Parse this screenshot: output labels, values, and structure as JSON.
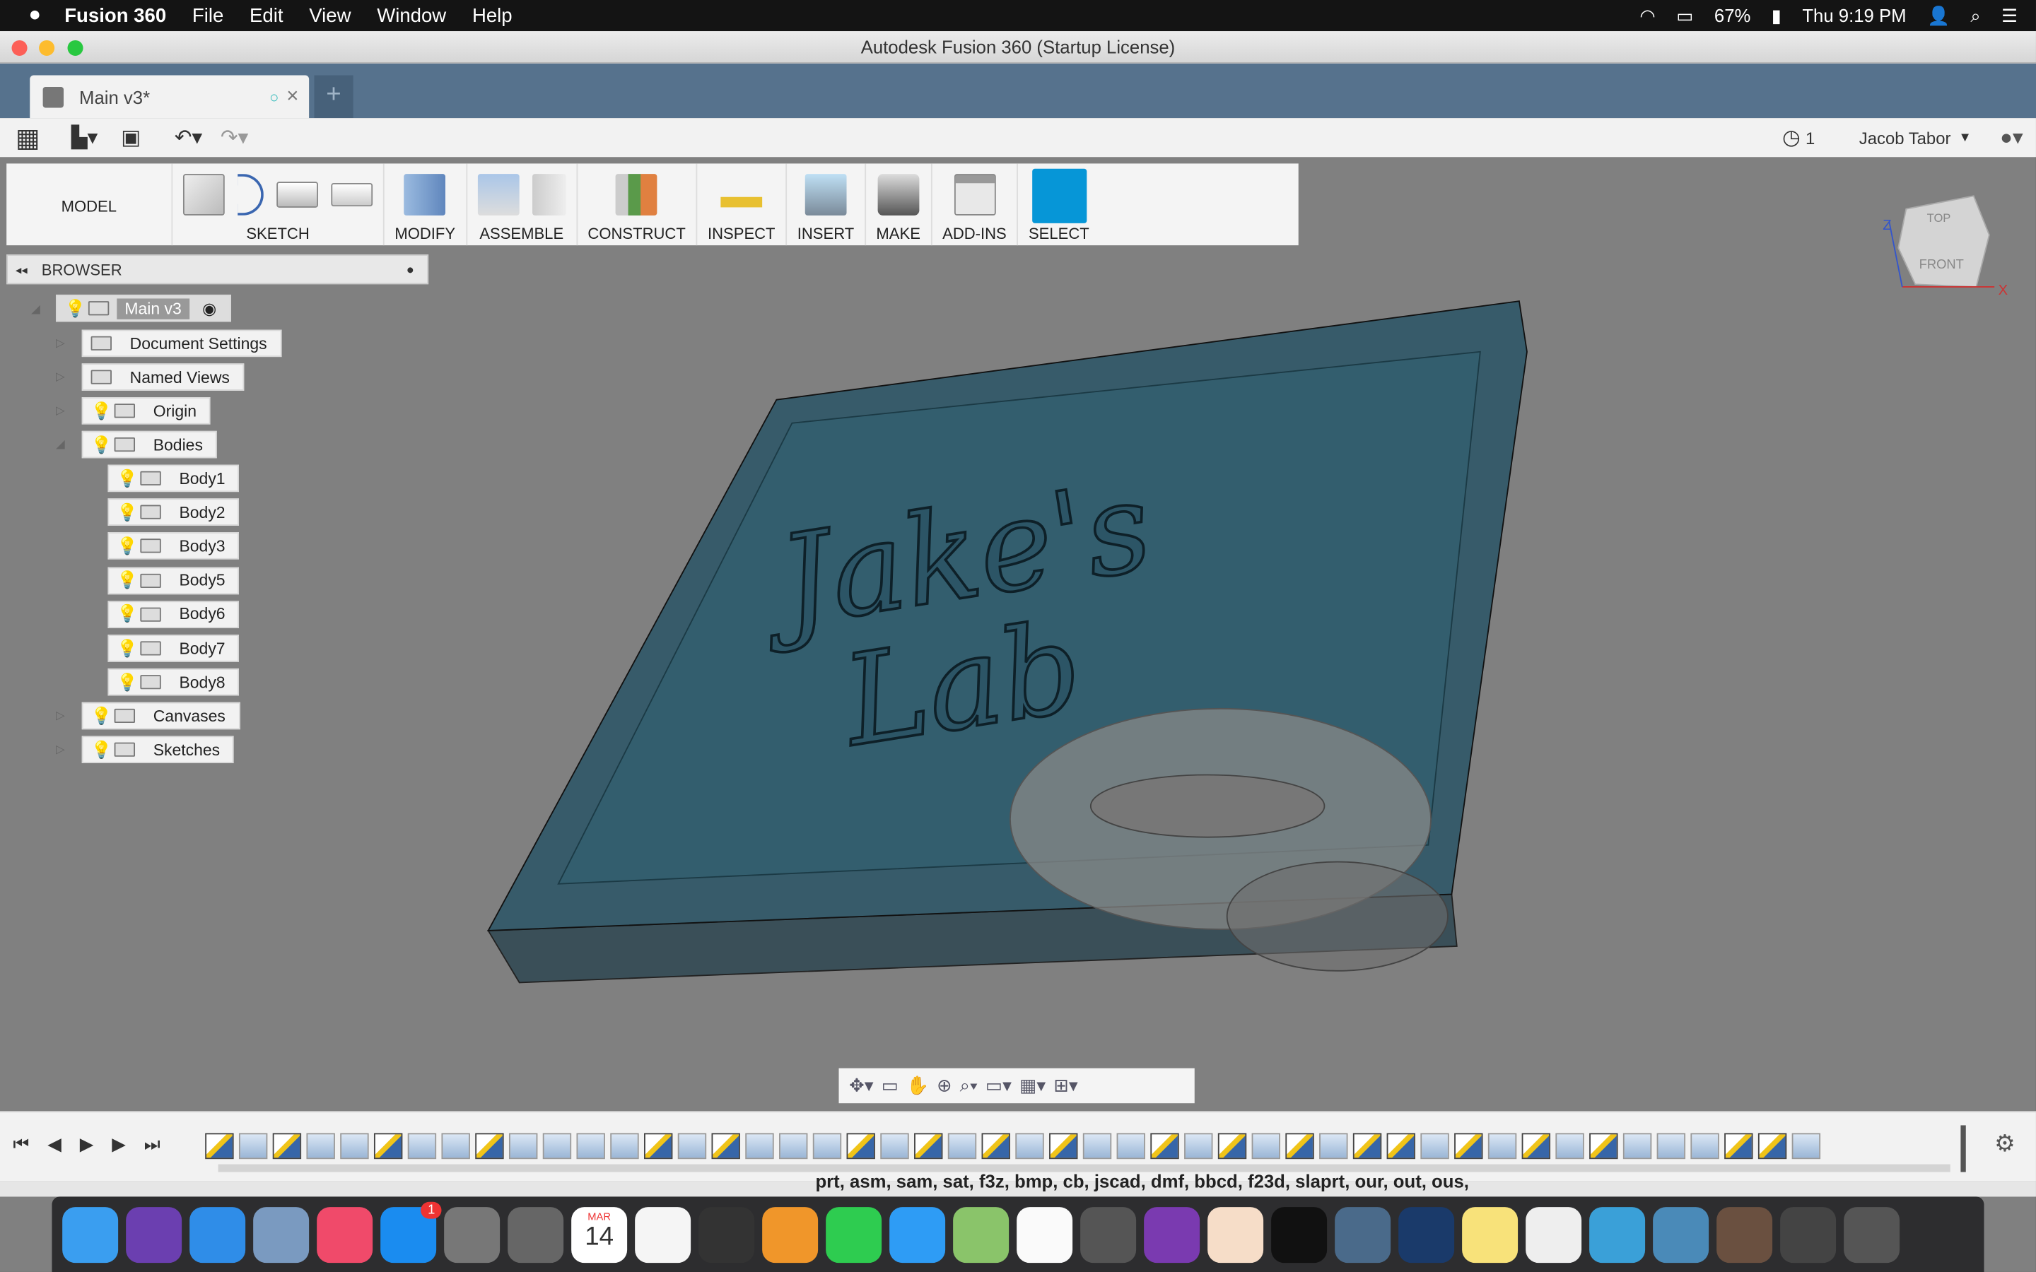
{
  "menubar": {
    "app": "Fusion 360",
    "items": [
      "File",
      "Edit",
      "View",
      "Window",
      "Help"
    ],
    "battery": "67%",
    "clock": "Thu 9:19 PM"
  },
  "window": {
    "title": "Autodesk Fusion 360 (Startup License)"
  },
  "tabs": [
    {
      "label": "Main v3*"
    }
  ],
  "quickbar": {
    "jobs": "1",
    "user": "Jacob Tabor"
  },
  "ribbon": {
    "workspace": "MODEL",
    "groups": [
      "SKETCH",
      "MODIFY",
      "ASSEMBLE",
      "CONSTRUCT",
      "INSPECT",
      "INSERT",
      "MAKE",
      "ADD-INS",
      "SELECT"
    ],
    "select_color": "#0696d7"
  },
  "browser": {
    "title": "BROWSER",
    "root": "Main v3",
    "items": [
      "Document Settings",
      "Named Views",
      "Origin",
      "Bodies",
      "Canvases",
      "Sketches"
    ],
    "bodies": [
      "Body1",
      "Body2",
      "Body3",
      "Body5",
      "Body6",
      "Body7",
      "Body8"
    ]
  },
  "viewcube": {
    "top": "TOP",
    "front": "FRONT",
    "z": "Z",
    "x": "X"
  },
  "viewport": {
    "model_text_1": "Jake's",
    "model_text_2": "Lab",
    "body_color": "#2c5566"
  },
  "timeline": [
    "sketch",
    "extrude",
    "sketch",
    "extrude",
    "canvas",
    "sketch",
    "extrude",
    "fillet",
    "sketch",
    "extrude",
    "move",
    "fillet",
    "move",
    "sketch",
    "extrude",
    "sketch",
    "extrude",
    "fillet",
    "extrude",
    "sketch",
    "extrude",
    "sketch",
    "extrude",
    "sketch",
    "extrude",
    "sketch",
    "extrude",
    "extrude",
    "sketch",
    "extrude",
    "sketch",
    "extrude",
    "sketch",
    "extrude",
    "sketch",
    "sketch",
    "extrude",
    "sketch",
    "extrude",
    "sketch",
    "extrude",
    "sketch",
    "extrude",
    "fillet",
    "fillet",
    "sketch",
    "sketch",
    "extrude"
  ],
  "background_text": "prt, asm, sam, sat, f3z, bmp, cb, jscad, dmf, bbcd, f23d, slaprt, our, out, ous,",
  "dock": [
    "finder",
    "siri",
    "safari",
    "preview",
    "itunes",
    "app-store",
    "launchpad",
    "system-preferences",
    "calendar",
    "photos",
    "final-cut",
    "home",
    "facetime",
    "messages",
    "maps",
    "textedit",
    "calculator",
    "books",
    "fusion-360",
    "terminal",
    "image-capture",
    "quicktime",
    "notes",
    "music-file",
    "downloads",
    "folder",
    "documents",
    "desktop",
    "trash"
  ],
  "dock_badge": "1",
  "calendar": {
    "month": "MAR",
    "day": "14"
  }
}
